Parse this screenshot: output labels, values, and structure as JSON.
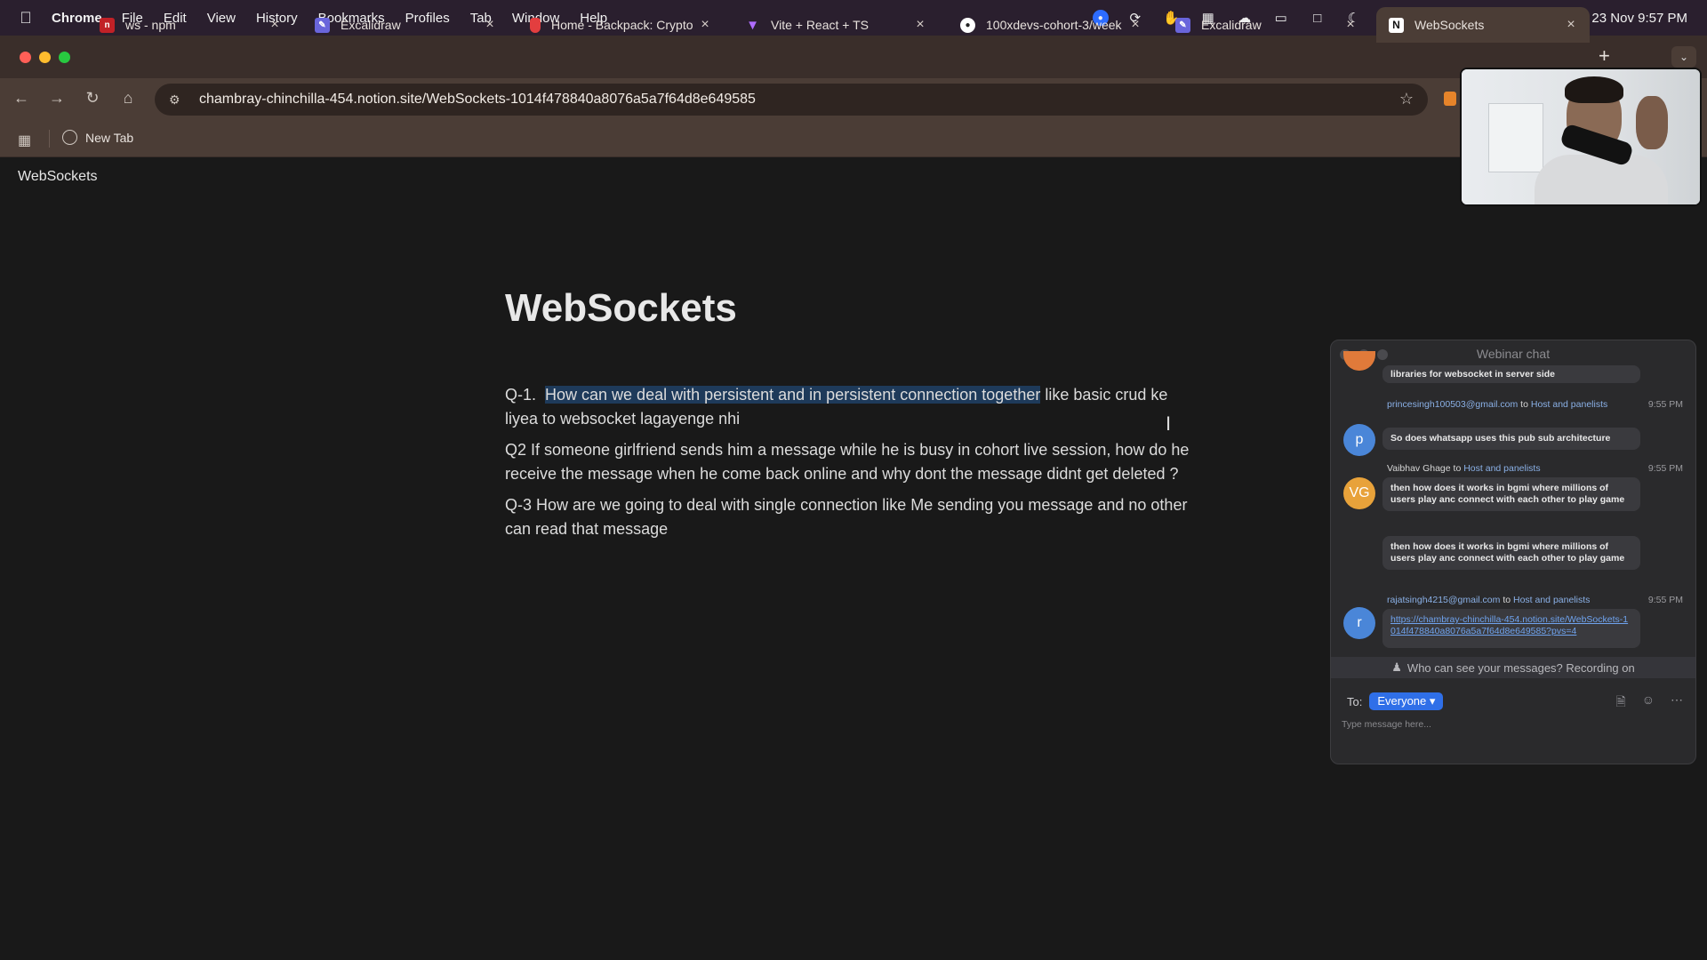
{
  "menubar": {
    "app_name": "Chrome",
    "items": [
      "File",
      "Edit",
      "View",
      "History",
      "Bookmarks",
      "Profiles",
      "Tab",
      "Window",
      "Help"
    ],
    "clock": "Sat 23 Nov  9:57 PM"
  },
  "tabs": [
    {
      "title": "ws - npm",
      "favicon": "npm-icon",
      "color": "#c12127",
      "active": false
    },
    {
      "title": "Excalidraw",
      "favicon": "excalidraw-icon",
      "color": "#6965db",
      "active": false
    },
    {
      "title": "Home - Backpack: Crypto",
      "favicon": "backpack-icon",
      "color": "#e33e3f",
      "active": false
    },
    {
      "title": "Vite + React + TS",
      "favicon": "vite-icon",
      "color": "#9b59ff",
      "active": false
    },
    {
      "title": "100xdevs-cohort-3/week",
      "favicon": "github-icon",
      "color": "#ffffff",
      "active": false
    },
    {
      "title": "Excalidraw",
      "favicon": "excalidraw-icon",
      "color": "#6965db",
      "active": false
    },
    {
      "title": "WebSockets",
      "favicon": "notion-icon",
      "color": "#ffffff",
      "active": true
    }
  ],
  "address_bar": {
    "url": "chambray-chinchilla-454.notion.site/WebSockets-1014f478840a8076a5a7f64d8e649585"
  },
  "bookmarks": [
    {
      "label": "New Tab"
    }
  ],
  "page": {
    "breadcrumb": "WebSockets",
    "title": "WebSockets",
    "q1_prefix": "Q-1.  ",
    "q1_highlight": "How can we deal with persistent and in persistent connection together",
    "q1_rest": " like basic crud ke liyea to websocket lagayenge nhi",
    "q2": "Q2 If someone girlfriend sends him a message while he is  busy in cohort live session, how do he receive the message when he come back online and why dont the message didnt get deleted ?",
    "q3": "Q-3 How are we going to deal with single connection like Me sending you message and no other can read that message"
  },
  "chat": {
    "title": "Webinar chat",
    "messages": [
      {
        "text": "libraries for websocket in server side"
      },
      {
        "sender": "princesingh100503@gmail.com",
        "to_word": "to",
        "recipient": "Host and panelists",
        "time": "9:55 PM",
        "avatar": "p",
        "avatar_color": "#4a86d8",
        "text": "So does whatsapp uses this pub sub architecture"
      },
      {
        "sender": "Vaibhav Ghage",
        "to_word": "to",
        "recipient": "Host and panelists",
        "time": "9:55 PM",
        "avatar": "VG",
        "avatar_color": "#e8a23a",
        "text": "then how does it works in bgmi where millions of users play anc connect with each other to play game",
        "text2": "then how does it works in bgmi where millions of users play anc connect with each other to play game"
      },
      {
        "sender": "rajatsingh4215@gmail.com",
        "to_word": "to",
        "recipient": "Host and panelists",
        "time": "9:55 PM",
        "avatar": "r",
        "avatar_color": "#4a86d8",
        "text": "https://chambray-chinchilla-454.notion.site/WebSockets-1014f478840a8076a5a7f64d8e649585?pvs=4"
      }
    ],
    "notice": "Who can see your messages? Recording on",
    "to_label": "To:",
    "audience": "Everyone",
    "placeholder": "Type message here..."
  }
}
